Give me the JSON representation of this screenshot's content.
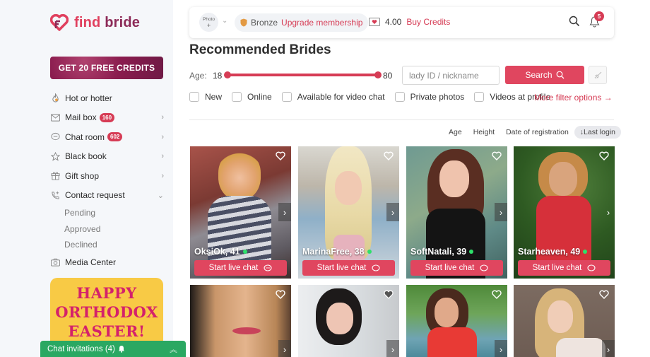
{
  "brand": {
    "name_part1": "find",
    "name_part2": "bride",
    "accent": "#e0405e",
    "secondary": "#8c2a57"
  },
  "sidebar": {
    "promo_button": "GET 20 FREE CREDITS",
    "items": [
      {
        "label": "Hot or hotter",
        "icon": "flame-icon"
      },
      {
        "label": "Mail box",
        "icon": "envelope-icon",
        "badge": "160",
        "has_chevron": true
      },
      {
        "label": "Chat room",
        "icon": "chat-bubble-icon",
        "badge": "602",
        "has_chevron": true
      },
      {
        "label": "Black book",
        "icon": "star-icon",
        "has_chevron": true
      },
      {
        "label": "Gift shop",
        "icon": "gift-icon",
        "has_chevron": true
      },
      {
        "label": "Contact request",
        "icon": "phone-plus-icon",
        "expanded": true,
        "sub_items": [
          "Pending",
          "Approved",
          "Declined"
        ]
      },
      {
        "label": "Media Center",
        "icon": "camera-icon"
      }
    ],
    "banner": {
      "lines": [
        "HAPPY",
        "ORTHODOX",
        "EASTER!"
      ]
    },
    "chat_invitations": "Chat invitations (4)"
  },
  "topbar": {
    "photo_label": "Photo",
    "photo_plus": "+",
    "membership_tier": "Bronze",
    "upgrade_label": "Upgrade membership",
    "credits_amount": "4.00",
    "buy_credits_label": "Buy Credits",
    "notification_count": "5"
  },
  "main": {
    "title": "Recommended Brides",
    "age": {
      "label": "Age:",
      "min": "18",
      "max": "80",
      "range_min": 18,
      "range_max": 80
    },
    "search": {
      "placeholder": "lady ID / nickname",
      "value": "",
      "button_label": "Search"
    },
    "filters": [
      "New",
      "Online",
      "Available for video chat",
      "Private photos",
      "Videos at profile"
    ],
    "more_filters": "More filter options →",
    "sort": {
      "options": [
        "Age",
        "Height",
        "Date of registration"
      ],
      "active": "↓Last login"
    },
    "chat_button_label": "Start live chat",
    "profiles": [
      {
        "name": "OksiOk, 41",
        "online": true
      },
      {
        "name": "MarinaFree, 38",
        "online": true
      },
      {
        "name": "SoftNatali, 39",
        "online": true
      },
      {
        "name": "Starheaven, 49",
        "online": true
      },
      {
        "name": ""
      },
      {
        "name": ""
      },
      {
        "name": ""
      },
      {
        "name": ""
      }
    ]
  }
}
